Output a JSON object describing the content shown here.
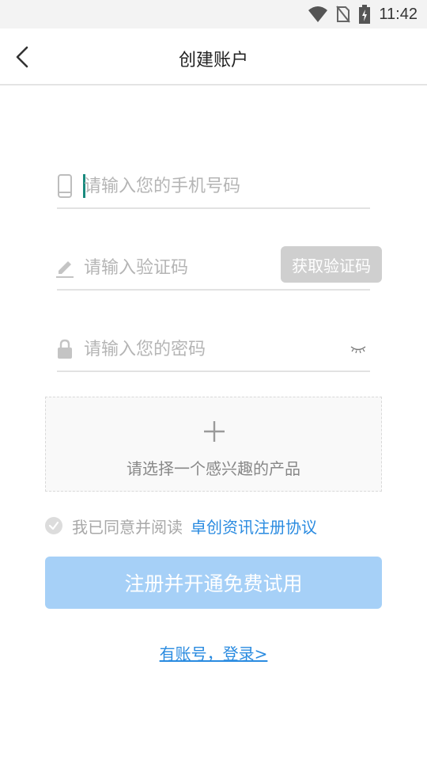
{
  "status_bar": {
    "time": "11:42"
  },
  "header": {
    "title": "创建账户"
  },
  "form": {
    "phone": {
      "placeholder": "请输入您的手机号码",
      "value": ""
    },
    "code": {
      "placeholder": "请输入验证码",
      "value": "",
      "button_label": "获取验证码"
    },
    "password": {
      "placeholder": "请输入您的密码",
      "value": ""
    }
  },
  "product": {
    "label": "请选择一个感兴趣的产品"
  },
  "agreement": {
    "text": "我已同意并阅读",
    "link": "卓创资讯注册协议"
  },
  "register_button": {
    "label": "注册并开通免费试用"
  },
  "login_link": {
    "label": "有账号，登录>"
  },
  "colors": {
    "accent": "#2a8be0",
    "button_disabled": "#a6d0f7",
    "code_button": "#cfcfcf"
  }
}
